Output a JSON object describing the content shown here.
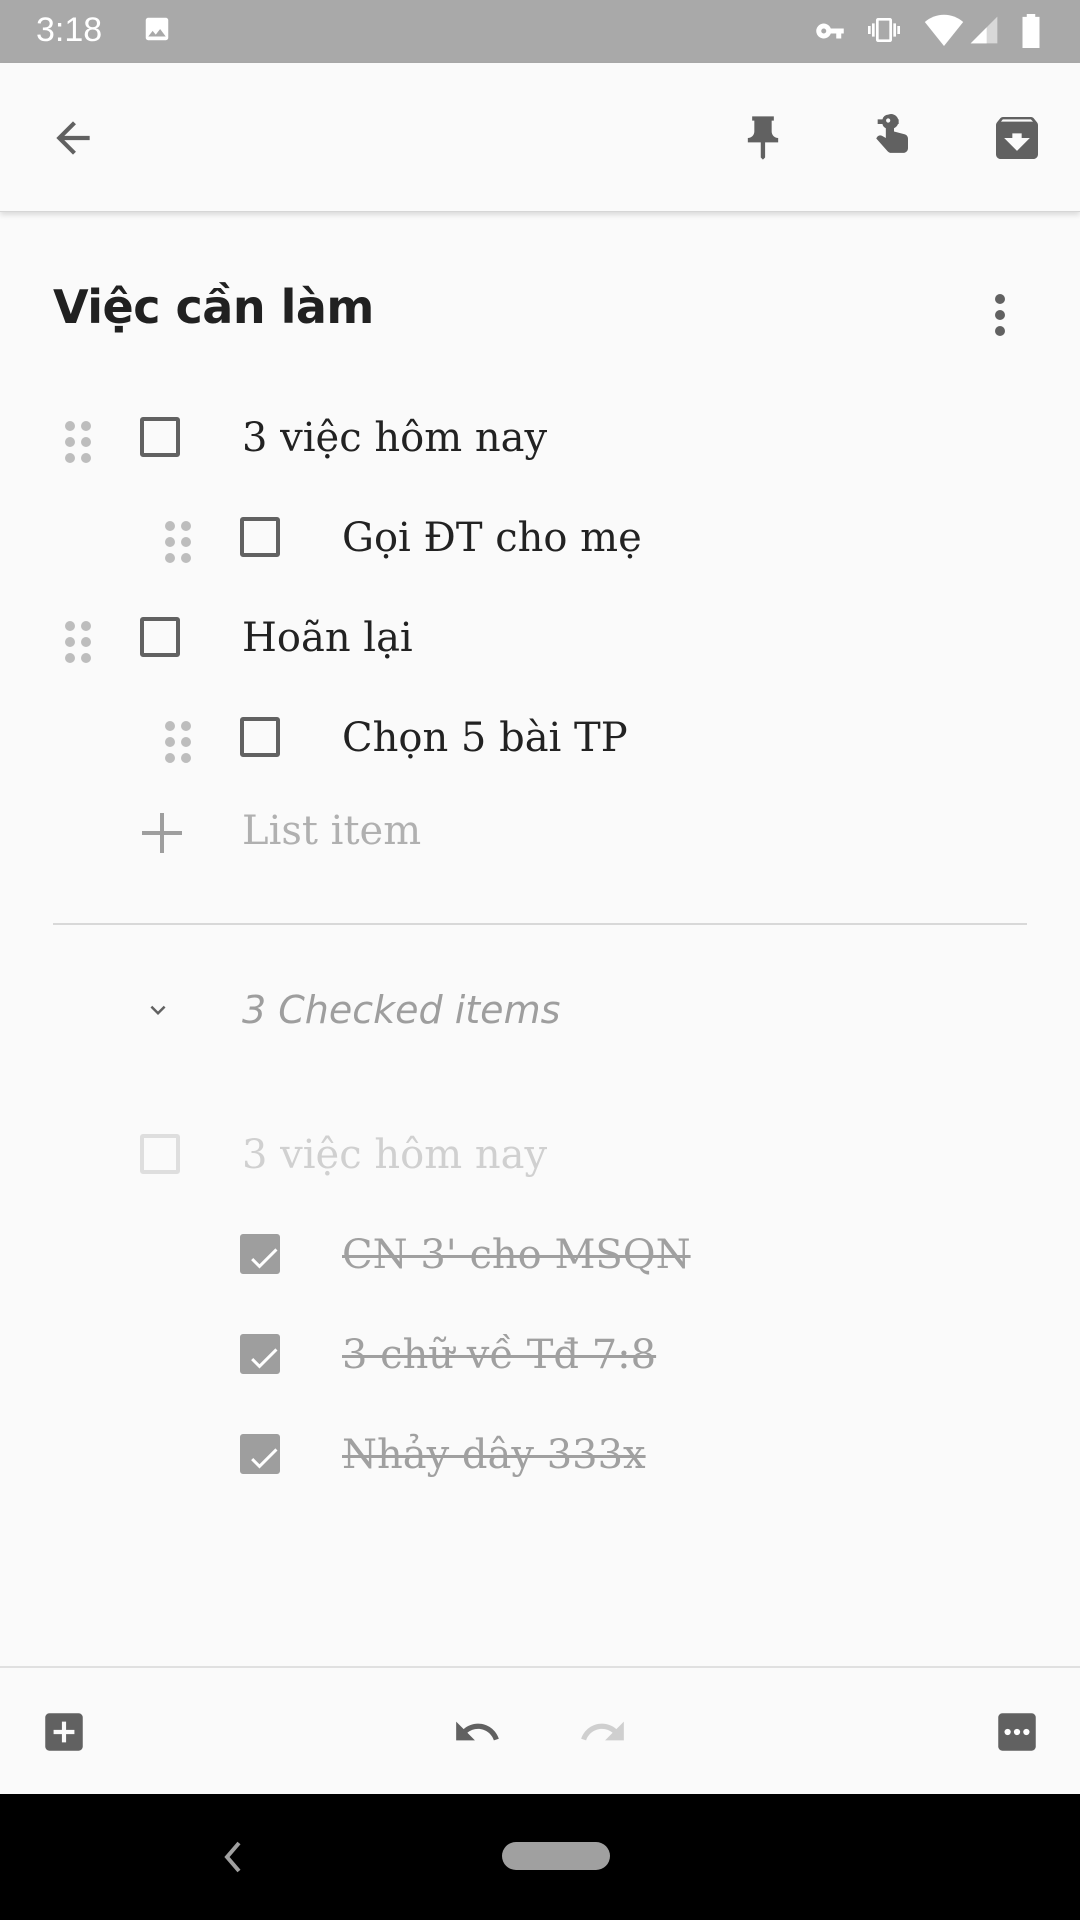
{
  "status_bar": {
    "time": "3:18",
    "icons": [
      "image-icon",
      "vpn-key-icon",
      "vibrate-icon",
      "wifi-icon",
      "signal-icon",
      "battery-icon"
    ]
  },
  "toolbar": {
    "icons": [
      "back-arrow-icon",
      "pin-icon",
      "reminder-icon",
      "archive-icon"
    ]
  },
  "note": {
    "title": "Việc cần làm",
    "items": [
      {
        "label": "3 việc hôm nay",
        "checked": false
      },
      {
        "label": "Gọi ĐT cho mẹ",
        "checked": false
      },
      {
        "label": "Hoãn lại",
        "checked": false
      },
      {
        "label": "Chọn 5 bài TP",
        "checked": false
      }
    ],
    "add_item_placeholder": "List item",
    "checked_header": "3 Checked items",
    "checked_parent": "3 việc hôm nay",
    "checked_items": [
      {
        "label": "CN 3' cho MSQN",
        "checked": true
      },
      {
        "label": "3 chữ về Tđ 7:8",
        "checked": true
      },
      {
        "label": "Nhảy dây 333x",
        "checked": true
      }
    ]
  },
  "bottom_bar": {
    "icons": [
      "add-box-icon",
      "undo-icon",
      "redo-icon",
      "more-horiz-icon"
    ]
  },
  "colors": {
    "status_bar": "#a9a9a9",
    "background": "#fafafa",
    "icon": "#616161",
    "checked_box": "#9e9e9e"
  }
}
